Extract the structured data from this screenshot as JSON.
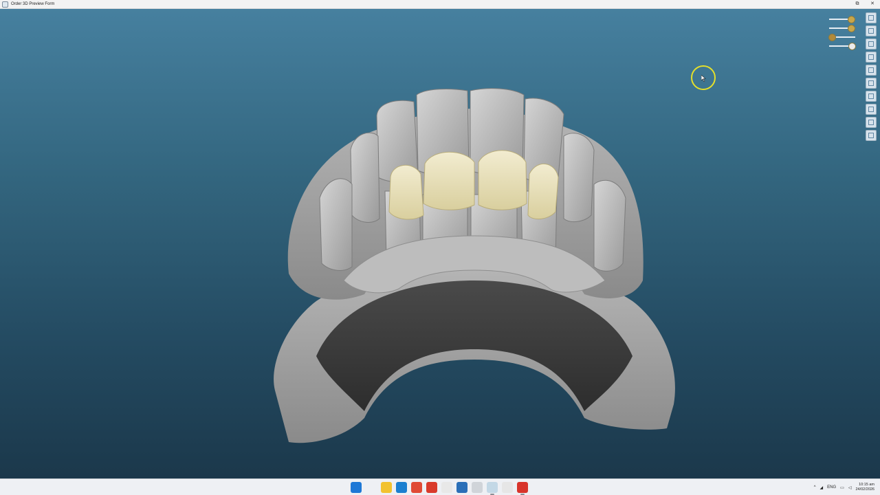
{
  "window": {
    "title": "Order 3D Preview Form",
    "controls": {
      "restore": "⧉",
      "close": "✕"
    }
  },
  "sliders": [
    {
      "name": "upper-model-opacity",
      "level": 0.82,
      "thumb_color": "#c8a64a"
    },
    {
      "name": "lower-model-opacity",
      "level": 0.82,
      "thumb_color": "#c8a64a"
    },
    {
      "name": "antagonist-opacity",
      "level": 0.08,
      "thumb_color": "#b08a3a"
    },
    {
      "name": "restoration-opacity",
      "level": 0.85,
      "thumb_color": "#ececec"
    }
  ],
  "toolbar": {
    "tools": [
      "view-front-icon",
      "view-back-icon",
      "view-left-icon",
      "view-right-icon",
      "view-top-icon",
      "view-bottom-icon",
      "layers-icon",
      "color-icon",
      "screenshot-icon",
      "settings-icon"
    ]
  },
  "colors": {
    "viewport_top": "#46809f",
    "viewport_bottom": "#1b384b",
    "model_gray": "#a8a8a8",
    "restoration": "#ece6c3",
    "cursor_ring": "#e5e02a"
  },
  "taskbar": {
    "apps": [
      {
        "name": "start-icon",
        "color": "#1e78d6"
      },
      {
        "name": "search-icon",
        "color": "#eef0f4"
      },
      {
        "name": "file-explorer-icon",
        "color": "#f2c230"
      },
      {
        "name": "edge-icon",
        "color": "#1b7fd0"
      },
      {
        "name": "chrome-icon",
        "color": "#e04a35"
      },
      {
        "name": "media-icon",
        "color": "#d93a2b"
      },
      {
        "name": "pdf-icon",
        "color": "#e8e8e8"
      },
      {
        "name": "dental-app-icon",
        "color": "#2a6fb8"
      },
      {
        "name": "viewer-icon",
        "color": "#d0d4d9"
      },
      {
        "name": "design-app-icon",
        "color": "#c3d8e6"
      },
      {
        "name": "teeth-app-icon",
        "color": "#e6e6e6"
      },
      {
        "name": "order-app-icon",
        "color": "#d8342b"
      }
    ],
    "tray": {
      "chevron": "^",
      "language": "ENG",
      "time": "10:15 am",
      "date": "24/02/2026"
    }
  }
}
